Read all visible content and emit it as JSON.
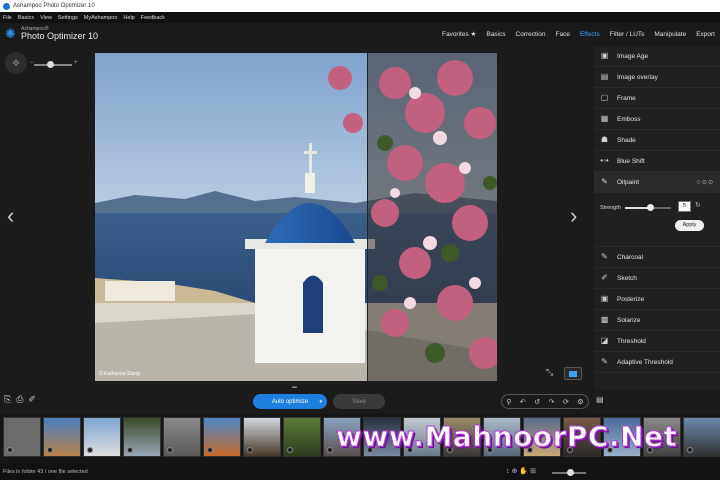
{
  "window": {
    "title": "Ashampoo Photo Optimizer 10"
  },
  "menu": [
    "File",
    "Basics",
    "View",
    "Settings",
    "MyAshampoo",
    "Help",
    "Feedback"
  ],
  "logo": {
    "brand": "Ashampoo®",
    "product": "Photo Optimizer 10"
  },
  "nav_tabs": [
    {
      "label": "Favorites ★",
      "active": false
    },
    {
      "label": "Basics",
      "active": false
    },
    {
      "label": "Correction",
      "active": false
    },
    {
      "label": "Face",
      "active": false
    },
    {
      "label": "Effects",
      "active": true
    },
    {
      "label": "Filter / LUTs",
      "active": false
    },
    {
      "label": "Manipulate",
      "active": false
    },
    {
      "label": "Export",
      "active": false
    }
  ],
  "effects_top": [
    {
      "label": "Image Age",
      "icon": "image-age-icon",
      "glyph": "▣"
    },
    {
      "label": "Image overlay",
      "icon": "image-overlay-icon",
      "glyph": "▤"
    },
    {
      "label": "Frame",
      "icon": "frame-icon",
      "glyph": "▢"
    },
    {
      "label": "Emboss",
      "icon": "emboss-icon",
      "glyph": "▦"
    },
    {
      "label": "Shade",
      "icon": "shade-icon",
      "glyph": "☗"
    },
    {
      "label": "Blue Shift",
      "icon": "blue-shift-icon",
      "glyph": "•◦•"
    },
    {
      "label": "Oilpaint",
      "icon": "oilpaint-brush-icon",
      "glyph": "✎",
      "selected": true,
      "tools": "☆⊙⊙"
    }
  ],
  "oilpaint_settings": {
    "strength_label": "Strength",
    "strength_value": "5",
    "strength_fraction": 0.55,
    "apply_label": "Apply"
  },
  "effects_bottom": [
    {
      "label": "Charcoal",
      "icon": "charcoal-icon",
      "glyph": "✎"
    },
    {
      "label": "Sketch",
      "icon": "sketch-icon",
      "glyph": "✐"
    },
    {
      "label": "Posterize",
      "icon": "posterize-icon",
      "glyph": "▣"
    },
    {
      "label": "Solarize",
      "icon": "solarize-icon",
      "glyph": "▩"
    },
    {
      "label": "Threshold",
      "icon": "threshold-icon",
      "glyph": "◪"
    },
    {
      "label": "Adaptive Threshold",
      "icon": "adaptive-threshold-icon",
      "glyph": "✎"
    }
  ],
  "viewer": {
    "credit": "© Katharina Stang"
  },
  "toolbar": {
    "auto_optimize": "Auto optimize",
    "save": "Save"
  },
  "status": {
    "text": "Files in folder 43 / one file selected"
  },
  "watermark": "www.MahnoorPC.Net",
  "colors": {
    "accent": "#1e7fe0",
    "active_tab": "#3ba3ff",
    "panel_bg": "#202020"
  }
}
